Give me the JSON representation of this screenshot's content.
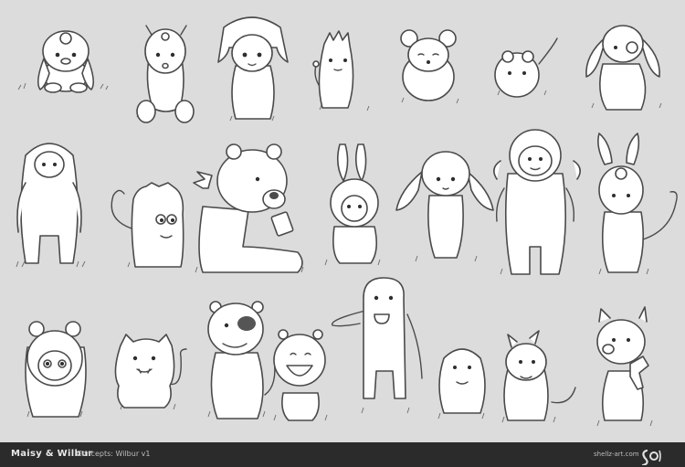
{
  "footer": {
    "title": "Maisy & Wilbur",
    "subtitle": "Concepts: Wilbur v1",
    "site": "shellz-art.com"
  },
  "colors": {
    "background": "#dcdcdc",
    "footer": "#2b2b2b",
    "line": "#4a4a4a"
  },
  "characters": [
    {
      "id": "r1c1",
      "icon": "floppy-ear-sitting-creature-icon"
    },
    {
      "id": "r1c2",
      "icon": "antenna-bear-creature-icon"
    },
    {
      "id": "r1c3",
      "icon": "hat-wearing-creature-icon"
    },
    {
      "id": "r1c4",
      "icon": "spiky-tailed-creature-icon"
    },
    {
      "id": "r1c5",
      "icon": "mouse-creature-icon"
    },
    {
      "id": "r1c6",
      "icon": "round-blob-creature-icon"
    },
    {
      "id": "r1c7",
      "icon": "long-ear-dog-creature-icon"
    },
    {
      "id": "r2c1",
      "icon": "furry-yeti-creature-icon"
    },
    {
      "id": "r2c2",
      "icon": "cat-tailed-creature-icon"
    },
    {
      "id": "r2c3",
      "icon": "winged-bear-with-phone-icon"
    },
    {
      "id": "r2c4",
      "icon": "bunny-suit-creature-icon"
    },
    {
      "id": "r2c5",
      "icon": "floppy-ear-bunny-creature-icon"
    },
    {
      "id": "r2c6",
      "icon": "sheep-suit-creature-icon"
    },
    {
      "id": "r2c7",
      "icon": "one-eyed-bunny-creature-icon"
    },
    {
      "id": "r3c1",
      "icon": "hooded-bear-creature-icon"
    },
    {
      "id": "r3c2",
      "icon": "fanged-cat-creature-icon"
    },
    {
      "id": "r3c3",
      "icon": "eye-patch-bear-creature-icon"
    },
    {
      "id": "r3c4",
      "icon": "laughing-blob-creature-icon"
    },
    {
      "id": "r3c5",
      "icon": "tall-tongue-creature-icon"
    },
    {
      "id": "r3c6",
      "icon": "small-penguin-creature-icon"
    },
    {
      "id": "r3c7",
      "icon": "horned-creature-icon"
    },
    {
      "id": "r3c8",
      "icon": "kitten-with-bow-icon"
    }
  ]
}
